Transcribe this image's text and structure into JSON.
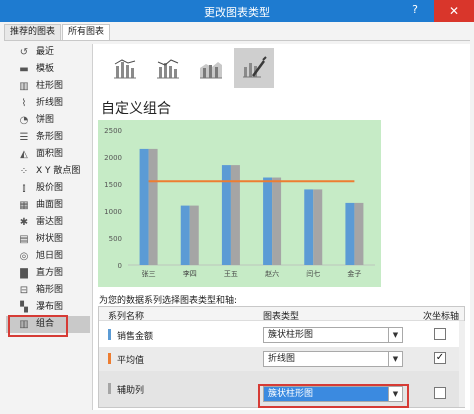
{
  "window": {
    "title": "更改图表类型",
    "help_icon": "question-icon",
    "close_icon": "close-icon"
  },
  "tabs": [
    {
      "label": "推荐的图表",
      "active": false
    },
    {
      "label": "所有图表",
      "active": true
    }
  ],
  "sidebar": {
    "items": [
      {
        "label": "最近",
        "icon": "recent-icon",
        "glyph": "↺"
      },
      {
        "label": "模板",
        "icon": "template-folder-icon",
        "glyph": "▬"
      },
      {
        "label": "柱形图",
        "icon": "column-chart-icon",
        "glyph": "▥"
      },
      {
        "label": "折线图",
        "icon": "line-chart-icon",
        "glyph": "⌇"
      },
      {
        "label": "饼图",
        "icon": "pie-chart-icon",
        "glyph": "◔"
      },
      {
        "label": "条形图",
        "icon": "bar-chart-icon",
        "glyph": "☰"
      },
      {
        "label": "面积图",
        "icon": "area-chart-icon",
        "glyph": "◭"
      },
      {
        "label": "X Y 散点图",
        "icon": "scatter-chart-icon",
        "glyph": "⁘"
      },
      {
        "label": "股价图",
        "icon": "stock-chart-icon",
        "glyph": "⫾"
      },
      {
        "label": "曲面图",
        "icon": "surface-chart-icon",
        "glyph": "▦"
      },
      {
        "label": "雷达图",
        "icon": "radar-chart-icon",
        "glyph": "✱"
      },
      {
        "label": "树状图",
        "icon": "treemap-chart-icon",
        "glyph": "▤"
      },
      {
        "label": "旭日图",
        "icon": "sunburst-chart-icon",
        "glyph": "◎"
      },
      {
        "label": "直方图",
        "icon": "histogram-chart-icon",
        "glyph": "▇"
      },
      {
        "label": "箱形图",
        "icon": "box-whisker-chart-icon",
        "glyph": "⊟"
      },
      {
        "label": "瀑布图",
        "icon": "waterfall-chart-icon",
        "glyph": "▚"
      },
      {
        "label": "组合",
        "icon": "combo-chart-icon",
        "glyph": "▥",
        "selected": true
      }
    ]
  },
  "subtypes": [
    {
      "icon": "clustered-column-line-icon",
      "selected": false
    },
    {
      "icon": "clustered-column-line-secondary-axis-icon",
      "selected": false
    },
    {
      "icon": "stacked-area-clustered-column-icon",
      "selected": false
    },
    {
      "icon": "custom-combination-icon",
      "selected": true
    }
  ],
  "section_title": "自定义组合",
  "chart_data": {
    "type": "bar",
    "categories": [
      "张三",
      "李四",
      "王五",
      "赵六",
      "闫七",
      "金子"
    ],
    "ylim": [
      0,
      2500
    ],
    "yticks": [
      "0",
      "500",
      "1000",
      "1500",
      "2000",
      "2500"
    ],
    "series": [
      {
        "name": "销售金额",
        "type": "bar",
        "color": "#5b9bd5",
        "values": [
          2150,
          1100,
          1850,
          1620,
          1400,
          1150
        ]
      },
      {
        "name": "辅助列",
        "type": "bar",
        "color": "#a5a5a5",
        "values": [
          2150,
          1100,
          1850,
          1620,
          1400,
          1150
        ]
      },
      {
        "name": "平均值",
        "type": "line",
        "color": "#ed7d31",
        "values": [
          1550,
          1550,
          1550,
          1550,
          1550,
          1550
        ]
      }
    ],
    "background": "#c6ebc6",
    "grid": false
  },
  "table": {
    "prompt": "为您的数据系列选择图表类型和轴:",
    "headers": {
      "series": "系列名称",
      "chart_type": "图表类型",
      "secondary_axis": "次坐标轴"
    },
    "rows": [
      {
        "name": "销售金额",
        "color": "#5b9bd5",
        "chart_type": "簇状柱形图",
        "secondary": false
      },
      {
        "name": "平均值",
        "color": "#ed7d31",
        "chart_type": "折线图",
        "secondary": true
      },
      {
        "name": "辅助列",
        "color": "#a5a5a5",
        "chart_type": "簇状柱形图",
        "secondary": false,
        "active": true
      }
    ]
  }
}
